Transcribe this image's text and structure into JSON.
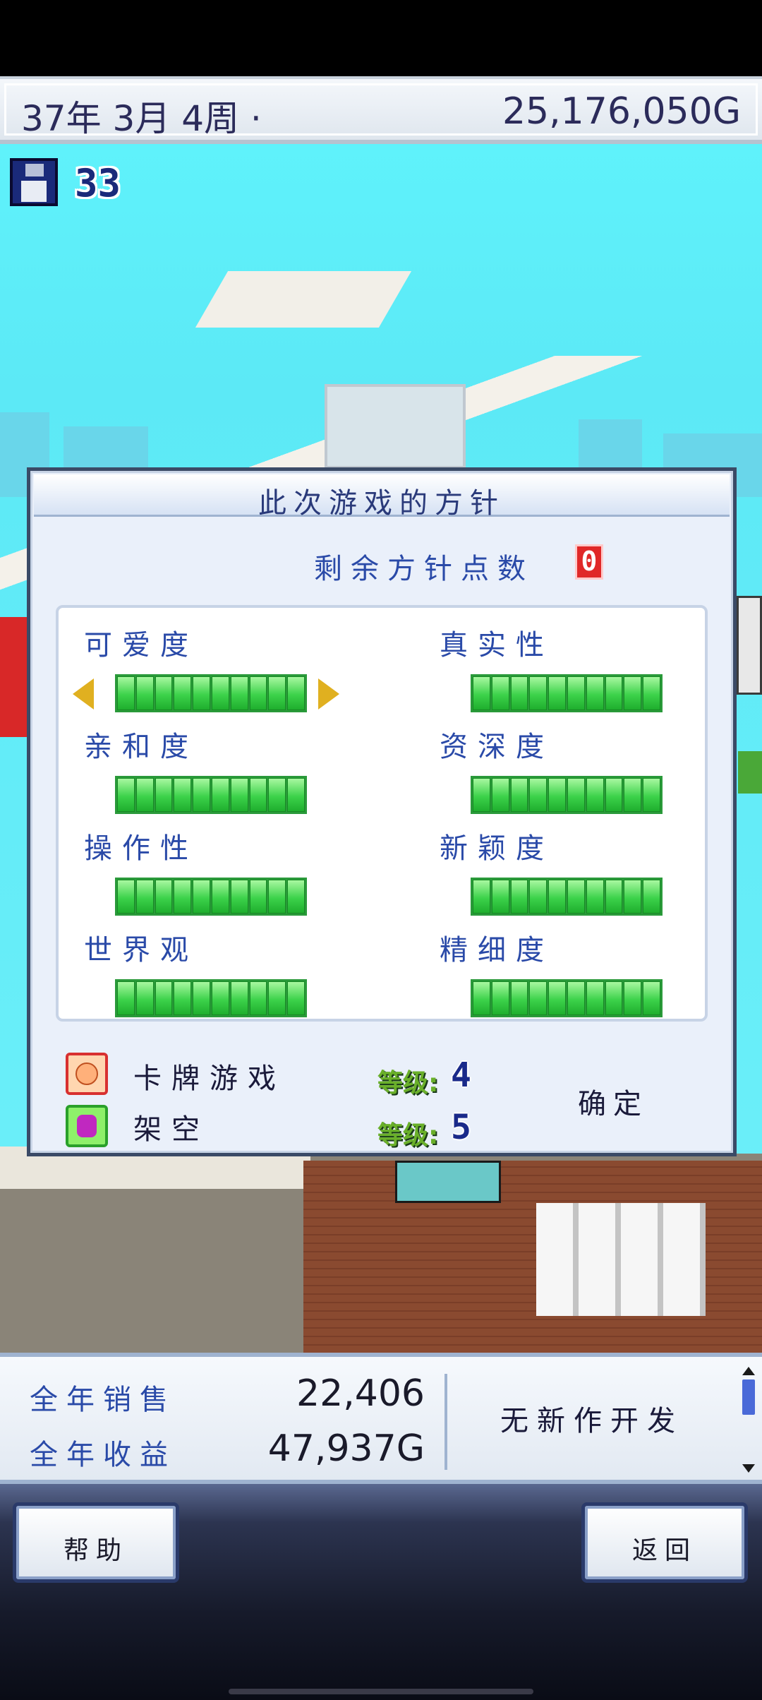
{
  "header": {
    "date": "37年 3月 4周 ·",
    "money": "25,176,050G"
  },
  "save": {
    "icon": "floppy-disk-icon",
    "count": "33"
  },
  "dialog": {
    "title": "此次游戏的方针",
    "points_label": "剩余方针点数",
    "points_value": "0",
    "params": [
      {
        "label": "可爱度",
        "level": 1.0,
        "selected": true
      },
      {
        "label": "真实性",
        "level": 1.0
      },
      {
        "label": "亲和度",
        "level": 1.0
      },
      {
        "label": "资深度",
        "level": 1.0
      },
      {
        "label": "操作性",
        "level": 1.0
      },
      {
        "label": "新颖度",
        "level": 1.0
      },
      {
        "label": "世界观",
        "level": 1.0
      },
      {
        "label": "精细度",
        "level": 1.0
      }
    ],
    "genres": [
      {
        "name": "卡牌游戏",
        "level_label": "等级:",
        "level": "4",
        "icon": "card-game-icon"
      },
      {
        "name": "架空",
        "level_label": "等级:",
        "level": "5",
        "icon": "fantasy-icon"
      }
    ],
    "confirm_label": "确定"
  },
  "sales": {
    "annual_sales_label": "全年销售",
    "annual_sales_value": "22,406",
    "annual_profit_label": "全年收益",
    "annual_profit_value": "47,937G",
    "dev_status": "无新作开发"
  },
  "nav": {
    "help_label": "帮助",
    "back_label": "返回"
  }
}
